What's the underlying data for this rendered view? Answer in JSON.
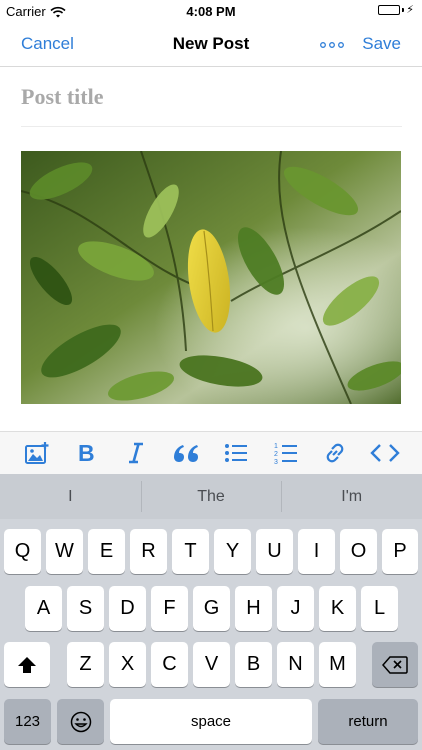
{
  "status": {
    "carrier": "Carrier",
    "time": "4:08 PM",
    "battery_level": 1.0
  },
  "nav": {
    "cancel_label": "Cancel",
    "title": "New Post",
    "save_label": "Save",
    "more_icon": "more-dots-icon"
  },
  "editor": {
    "title_placeholder": "Post title",
    "image": "green-leaves-photo"
  },
  "format_toolbar": [
    "insert-media-icon",
    "bold-icon",
    "italic-icon",
    "blockquote-icon",
    "unordered-list-icon",
    "ordered-list-icon",
    "link-icon",
    "html-code-icon"
  ],
  "keyboard": {
    "suggestions": [
      "I",
      "The",
      "I'm"
    ],
    "row1": [
      "Q",
      "W",
      "E",
      "R",
      "T",
      "Y",
      "U",
      "I",
      "O",
      "P"
    ],
    "row2": [
      "A",
      "S",
      "D",
      "F",
      "G",
      "H",
      "J",
      "K",
      "L"
    ],
    "row3": [
      "Z",
      "X",
      "C",
      "V",
      "B",
      "N",
      "M"
    ],
    "numbers_label": "123",
    "space_label": "space",
    "return_label": "return"
  },
  "colors": {
    "accent": "#2f7ed8",
    "placeholder": "#a9a9a9",
    "keyboard_bg": "#d0d4da"
  }
}
